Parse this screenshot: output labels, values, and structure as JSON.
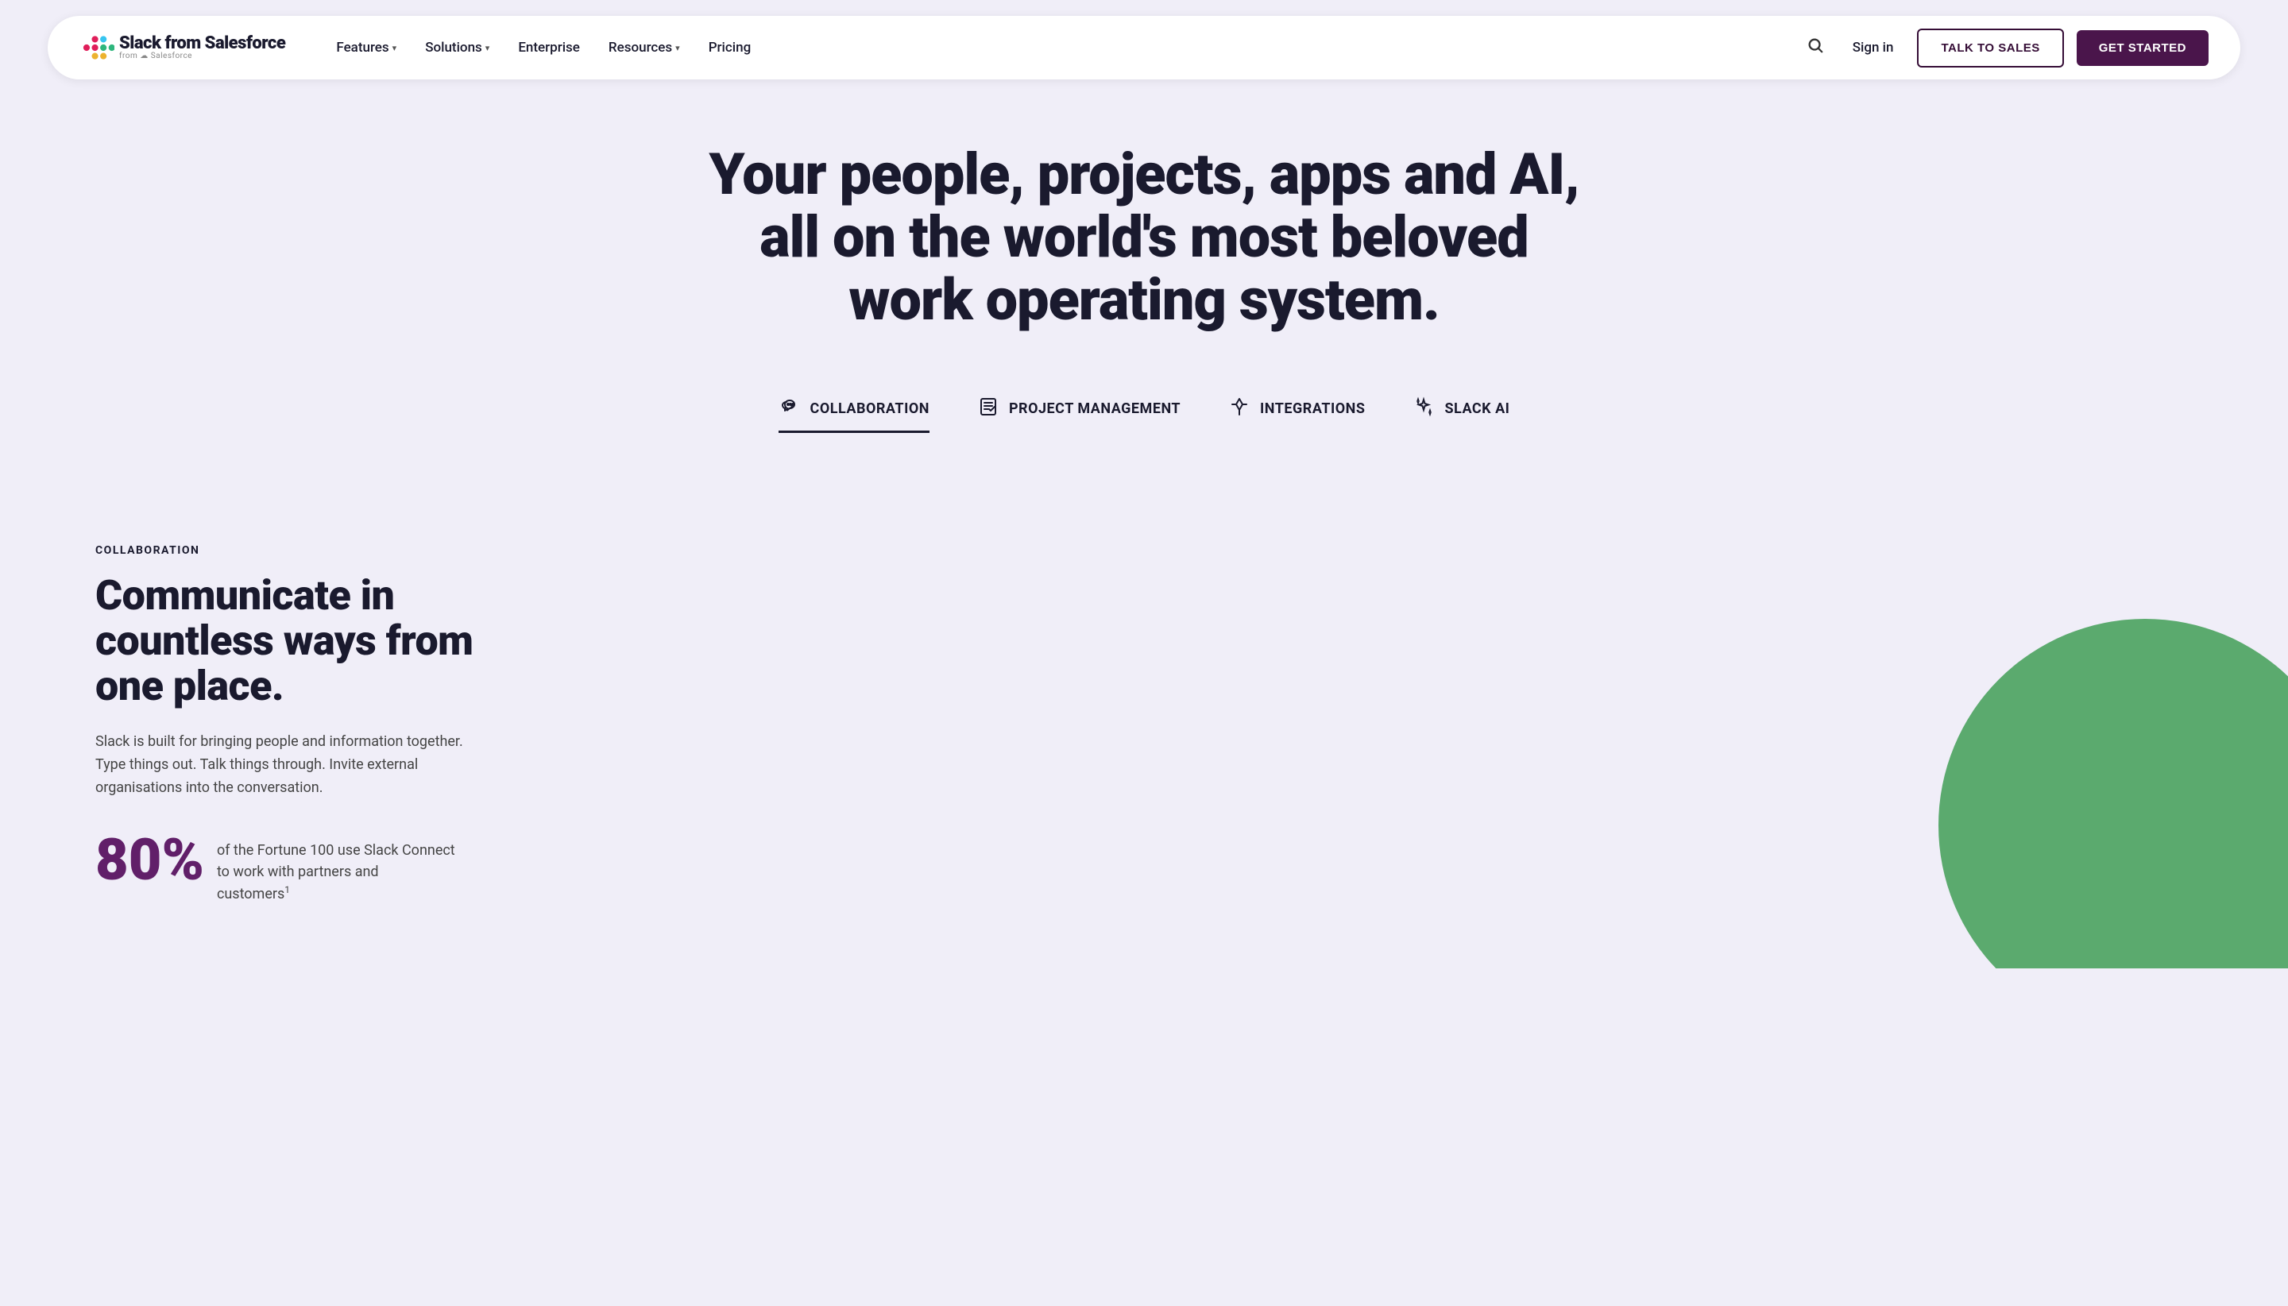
{
  "nav": {
    "logo_alt": "Slack from Salesforce",
    "links": [
      {
        "label": "Features",
        "has_dropdown": true
      },
      {
        "label": "Solutions",
        "has_dropdown": true
      },
      {
        "label": "Enterprise",
        "has_dropdown": false
      },
      {
        "label": "Resources",
        "has_dropdown": true
      },
      {
        "label": "Pricing",
        "has_dropdown": false
      }
    ],
    "signin_label": "Sign in",
    "talk_to_sales_label": "TALK TO SALES",
    "get_started_label": "GET STARTED"
  },
  "hero": {
    "title": "Your people, projects, apps and AI, all on the world's most beloved work operating system."
  },
  "tabs": [
    {
      "id": "collaboration",
      "label": "COLLABORATION",
      "icon": "✋",
      "active": true
    },
    {
      "id": "project-management",
      "label": "PROJECT MANAGEMENT",
      "icon": "📋",
      "active": false
    },
    {
      "id": "integrations",
      "label": "INTEGRATIONS",
      "icon": "⚡",
      "active": false
    },
    {
      "id": "slack-ai",
      "label": "SLACK AI",
      "icon": "✨",
      "active": false
    }
  ],
  "collaboration_section": {
    "label": "COLLABORATION",
    "title": "Communicate in countless ways from one place.",
    "description": "Slack is built for bringing people and information together. Type things out. Talk things through. Invite external organisations into the conversation.",
    "stat": {
      "number": "80%",
      "text": "of the Fortune 100 use Slack Connect to work with partners and customers",
      "footnote": "1"
    }
  },
  "colors": {
    "purple_dark": "#4a154b",
    "purple_accent": "#611f69",
    "green_circle": "#5baa6e",
    "bg_light": "#f0eef8",
    "text_dark": "#1a1a2e"
  }
}
